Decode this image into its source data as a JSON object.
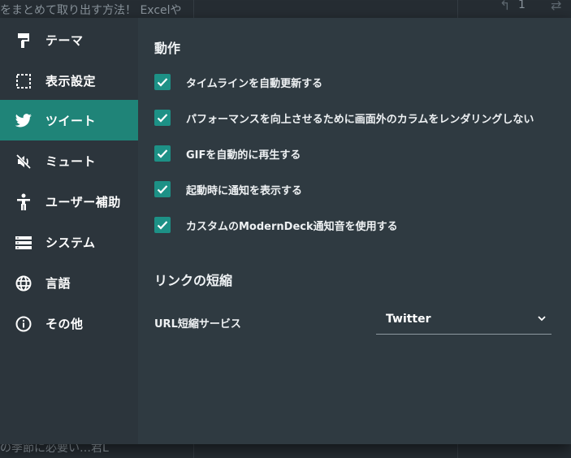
{
  "background": {
    "top_text": "をまとめて取り出す方法！ Excelや",
    "bottom_text": "の季節に必要い…君L",
    "reply_count": "1"
  },
  "sidebar": {
    "items": [
      {
        "label": "テーマ",
        "icon": "paint-roller-icon",
        "active": false
      },
      {
        "label": "表示設定",
        "icon": "display-settings-icon",
        "active": false
      },
      {
        "label": "ツイート",
        "icon": "twitter-bird-icon",
        "active": true
      },
      {
        "label": "ミュート",
        "icon": "mute-icon",
        "active": false
      },
      {
        "label": "ユーザー補助",
        "icon": "accessibility-icon",
        "active": false
      },
      {
        "label": "システム",
        "icon": "storage-icon",
        "active": false
      },
      {
        "label": "言語",
        "icon": "globe-icon",
        "active": false
      },
      {
        "label": "その他",
        "icon": "info-icon",
        "active": false
      }
    ]
  },
  "content": {
    "behavior_title": "動作",
    "options": [
      {
        "label": "タイムラインを自動更新する",
        "checked": true
      },
      {
        "label": "パフォーマンスを向上させるために画面外のカラムをレンダリングしない",
        "checked": true
      },
      {
        "label": "GIFを自動的に再生する",
        "checked": true
      },
      {
        "label": "起動時に通知を表示する",
        "checked": true
      },
      {
        "label": "カスタムのModernDeck通知音を使用する",
        "checked": true
      }
    ],
    "shortener_title": "リンクの短縮",
    "shortener_label": "URL短縮サービス",
    "shortener_value": "Twitter"
  },
  "colors": {
    "accent": "#1f8478",
    "checkbox": "#1d9186",
    "sidebar_bg": "#2c353c",
    "content_bg": "#2f3a41"
  }
}
